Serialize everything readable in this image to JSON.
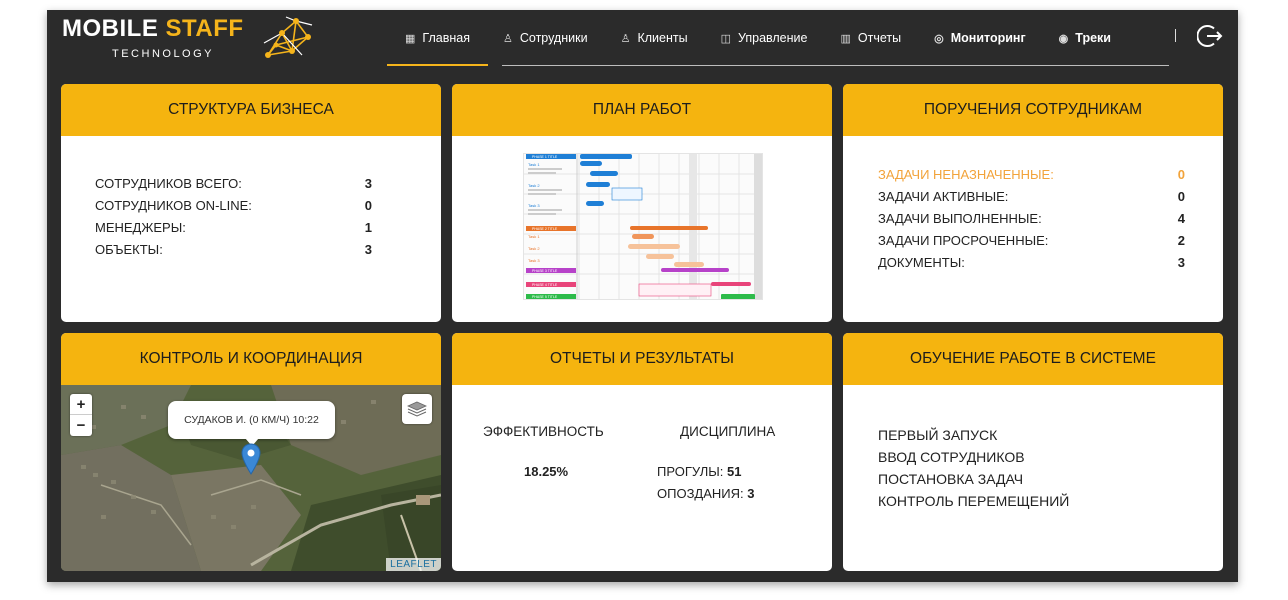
{
  "logo": {
    "word1": "MOBILE",
    "word2": "STAFF",
    "subtitle": "TECHNOLOGY"
  },
  "nav": {
    "items": [
      {
        "label": "Главная",
        "icon": "home-grid-icon"
      },
      {
        "label": "Сотрудники",
        "icon": "person-icon"
      },
      {
        "label": "Клиенты",
        "icon": "person-icon"
      },
      {
        "label": "Управление",
        "icon": "sliders-icon"
      },
      {
        "label": "Отчеты",
        "icon": "bar-chart-icon"
      },
      {
        "label": "Мониторинг",
        "icon": "compass-icon"
      },
      {
        "label": "Треки",
        "icon": "eye-icon"
      }
    ],
    "active": "Главная",
    "logout_icon": "logout-icon"
  },
  "colors": {
    "accent": "#f5b40f",
    "frame": "#2b2b2b",
    "highlight": "#f2a33a"
  },
  "structure": {
    "title": "Структура бизнеса",
    "rows": [
      {
        "label": "Сотрудников всего:",
        "value": "3"
      },
      {
        "label": "Сотрудников on-line:",
        "value": "0"
      },
      {
        "label": "Менеджеры:",
        "value": "1"
      },
      {
        "label": "Объекты:",
        "value": "3"
      }
    ]
  },
  "plan": {
    "title": "План работ",
    "gantt": {
      "phases": [
        "PHASE 1 TITLE",
        "PHASE 2 TITLE",
        "PHASE 3 TITLE",
        "PHASE 4 TITLE",
        "PHASE 5 TITLE"
      ],
      "tasks": [
        "Task 1",
        "Task 2",
        "Task 3",
        "Task 1",
        "Task 2",
        "Task 3"
      ]
    }
  },
  "tasks": {
    "title": "Поручения сотрудникам",
    "rows": [
      {
        "label": "Задачи неназначенные:",
        "value": "0",
        "highlight": true
      },
      {
        "label": "Задачи активные:",
        "value": "0"
      },
      {
        "label": "Задачи выполненные:",
        "value": "4"
      },
      {
        "label": "Задачи просроченные:",
        "value": "2"
      },
      {
        "label": "Документы:",
        "value": "3"
      }
    ]
  },
  "control": {
    "title": "Контроль и координация",
    "zoom_in": "+",
    "zoom_out": "−",
    "popup": "СУДАКОВ И. (0 КМ/Ч) 10:22",
    "attribution": "LEAFLET"
  },
  "reports": {
    "title": "Отчеты и результаты",
    "efficiency_label": "Эффективность",
    "efficiency_value": "18.25%",
    "discipline_label": "Дисциплина",
    "absences_label": "Прогулы:",
    "absences_value": "51",
    "late_label": "Опоздания:",
    "late_value": "3"
  },
  "learning": {
    "title": "Обучение работе в системе",
    "links": [
      "Первый запуск",
      "Ввод сотрудников",
      "Постановка задач",
      "Контроль перемещений"
    ]
  }
}
